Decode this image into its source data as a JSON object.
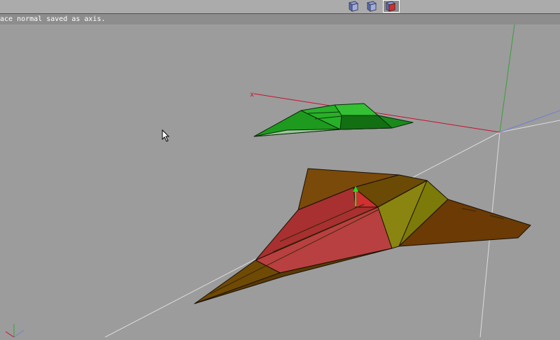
{
  "status": {
    "message": "ace normal saved as axis."
  },
  "toolbar": {
    "buttons": [
      {
        "name": "perspective-view-button",
        "icon": "cube-icon",
        "active": false
      },
      {
        "name": "side-view-button",
        "icon": "cube-icon",
        "active": false
      },
      {
        "name": "shaded-view-button",
        "icon": "cube-red-icon",
        "active": true
      }
    ]
  },
  "viewport": {
    "axis_x_label": "x",
    "colors": {
      "x_axis": "#c8102e",
      "y_axis": "#3a9e3a",
      "z_axis": "#6f7fd0",
      "grid": "#dcdcdc",
      "green_ship": "#22aa22",
      "brown_ship": "#7a4a0a",
      "olive_face": "#7c7a08",
      "selected_face": "#b03030",
      "normal_arrow": "#22dd22"
    }
  }
}
